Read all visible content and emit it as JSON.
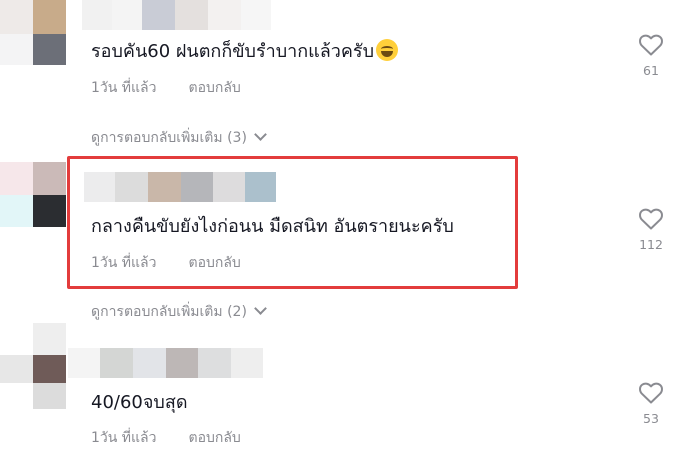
{
  "comments": [
    {
      "text": "รอบคัน60 ฝนตกก็ขับรำบากแล้วครับ",
      "emoji": "grinning-sweat-emoji",
      "time": "1วัน ที่แล้ว",
      "reply": "ตอบกลับ",
      "likes": "61",
      "more_replies": "ดูการตอบกลับเพิ่มเติม (3)"
    },
    {
      "text": "กลางคืนขับยังไงก่อนน มืดสนิท อันตรายนะครับ",
      "time": "1วัน ที่แล้ว",
      "reply": "ตอบกลับ",
      "likes": "112",
      "more_replies": "ดูการตอบกลับเพิ่มเติม (2)",
      "highlighted": true,
      "highlight_color": "#e33c3c"
    },
    {
      "text": "40/60จบสุด",
      "time": "1วัน ที่แล้ว",
      "reply": "ตอบกลับ",
      "likes": "53"
    }
  ],
  "colors": {
    "text": "#161823",
    "muted": "#8a8b91",
    "highlight": "#e33c3c"
  }
}
